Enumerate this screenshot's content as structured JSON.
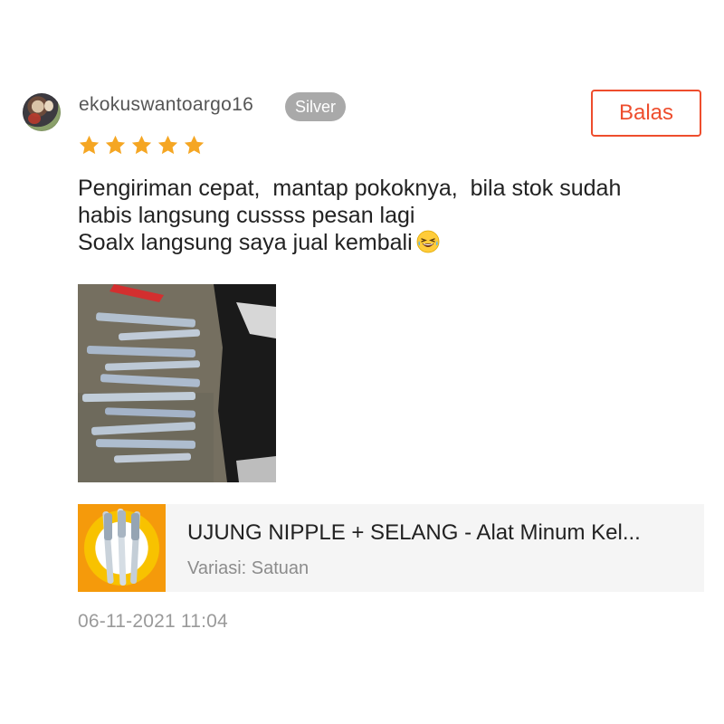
{
  "user": {
    "username": "ekokuswantoargo16",
    "badge": "Silver"
  },
  "actions": {
    "reply_label": "Balas"
  },
  "rating": {
    "stars": 5,
    "max": 5,
    "color": "#f5a623",
    "icon": "star-icon"
  },
  "review": {
    "lines": [
      "Pengiriman cepat,  mantap pokoknya,  bila stok sudah",
      "habis langsung cussss pesan lagi",
      "Soalx langsung saya jual kembali"
    ],
    "emoji": "grinning-squinting-face-with-tears-icon"
  },
  "product": {
    "name": "UJUNG NIPPLE + SELANG - Alat Minum Kel...",
    "variation_label": "Variasi:",
    "variation_value": "Satuan"
  },
  "timestamp": "06-11-2021 11:04",
  "colors": {
    "accent": "#ee4d2d",
    "badge_bg": "#a9a9a9",
    "card_bg": "#f5f5f5"
  }
}
